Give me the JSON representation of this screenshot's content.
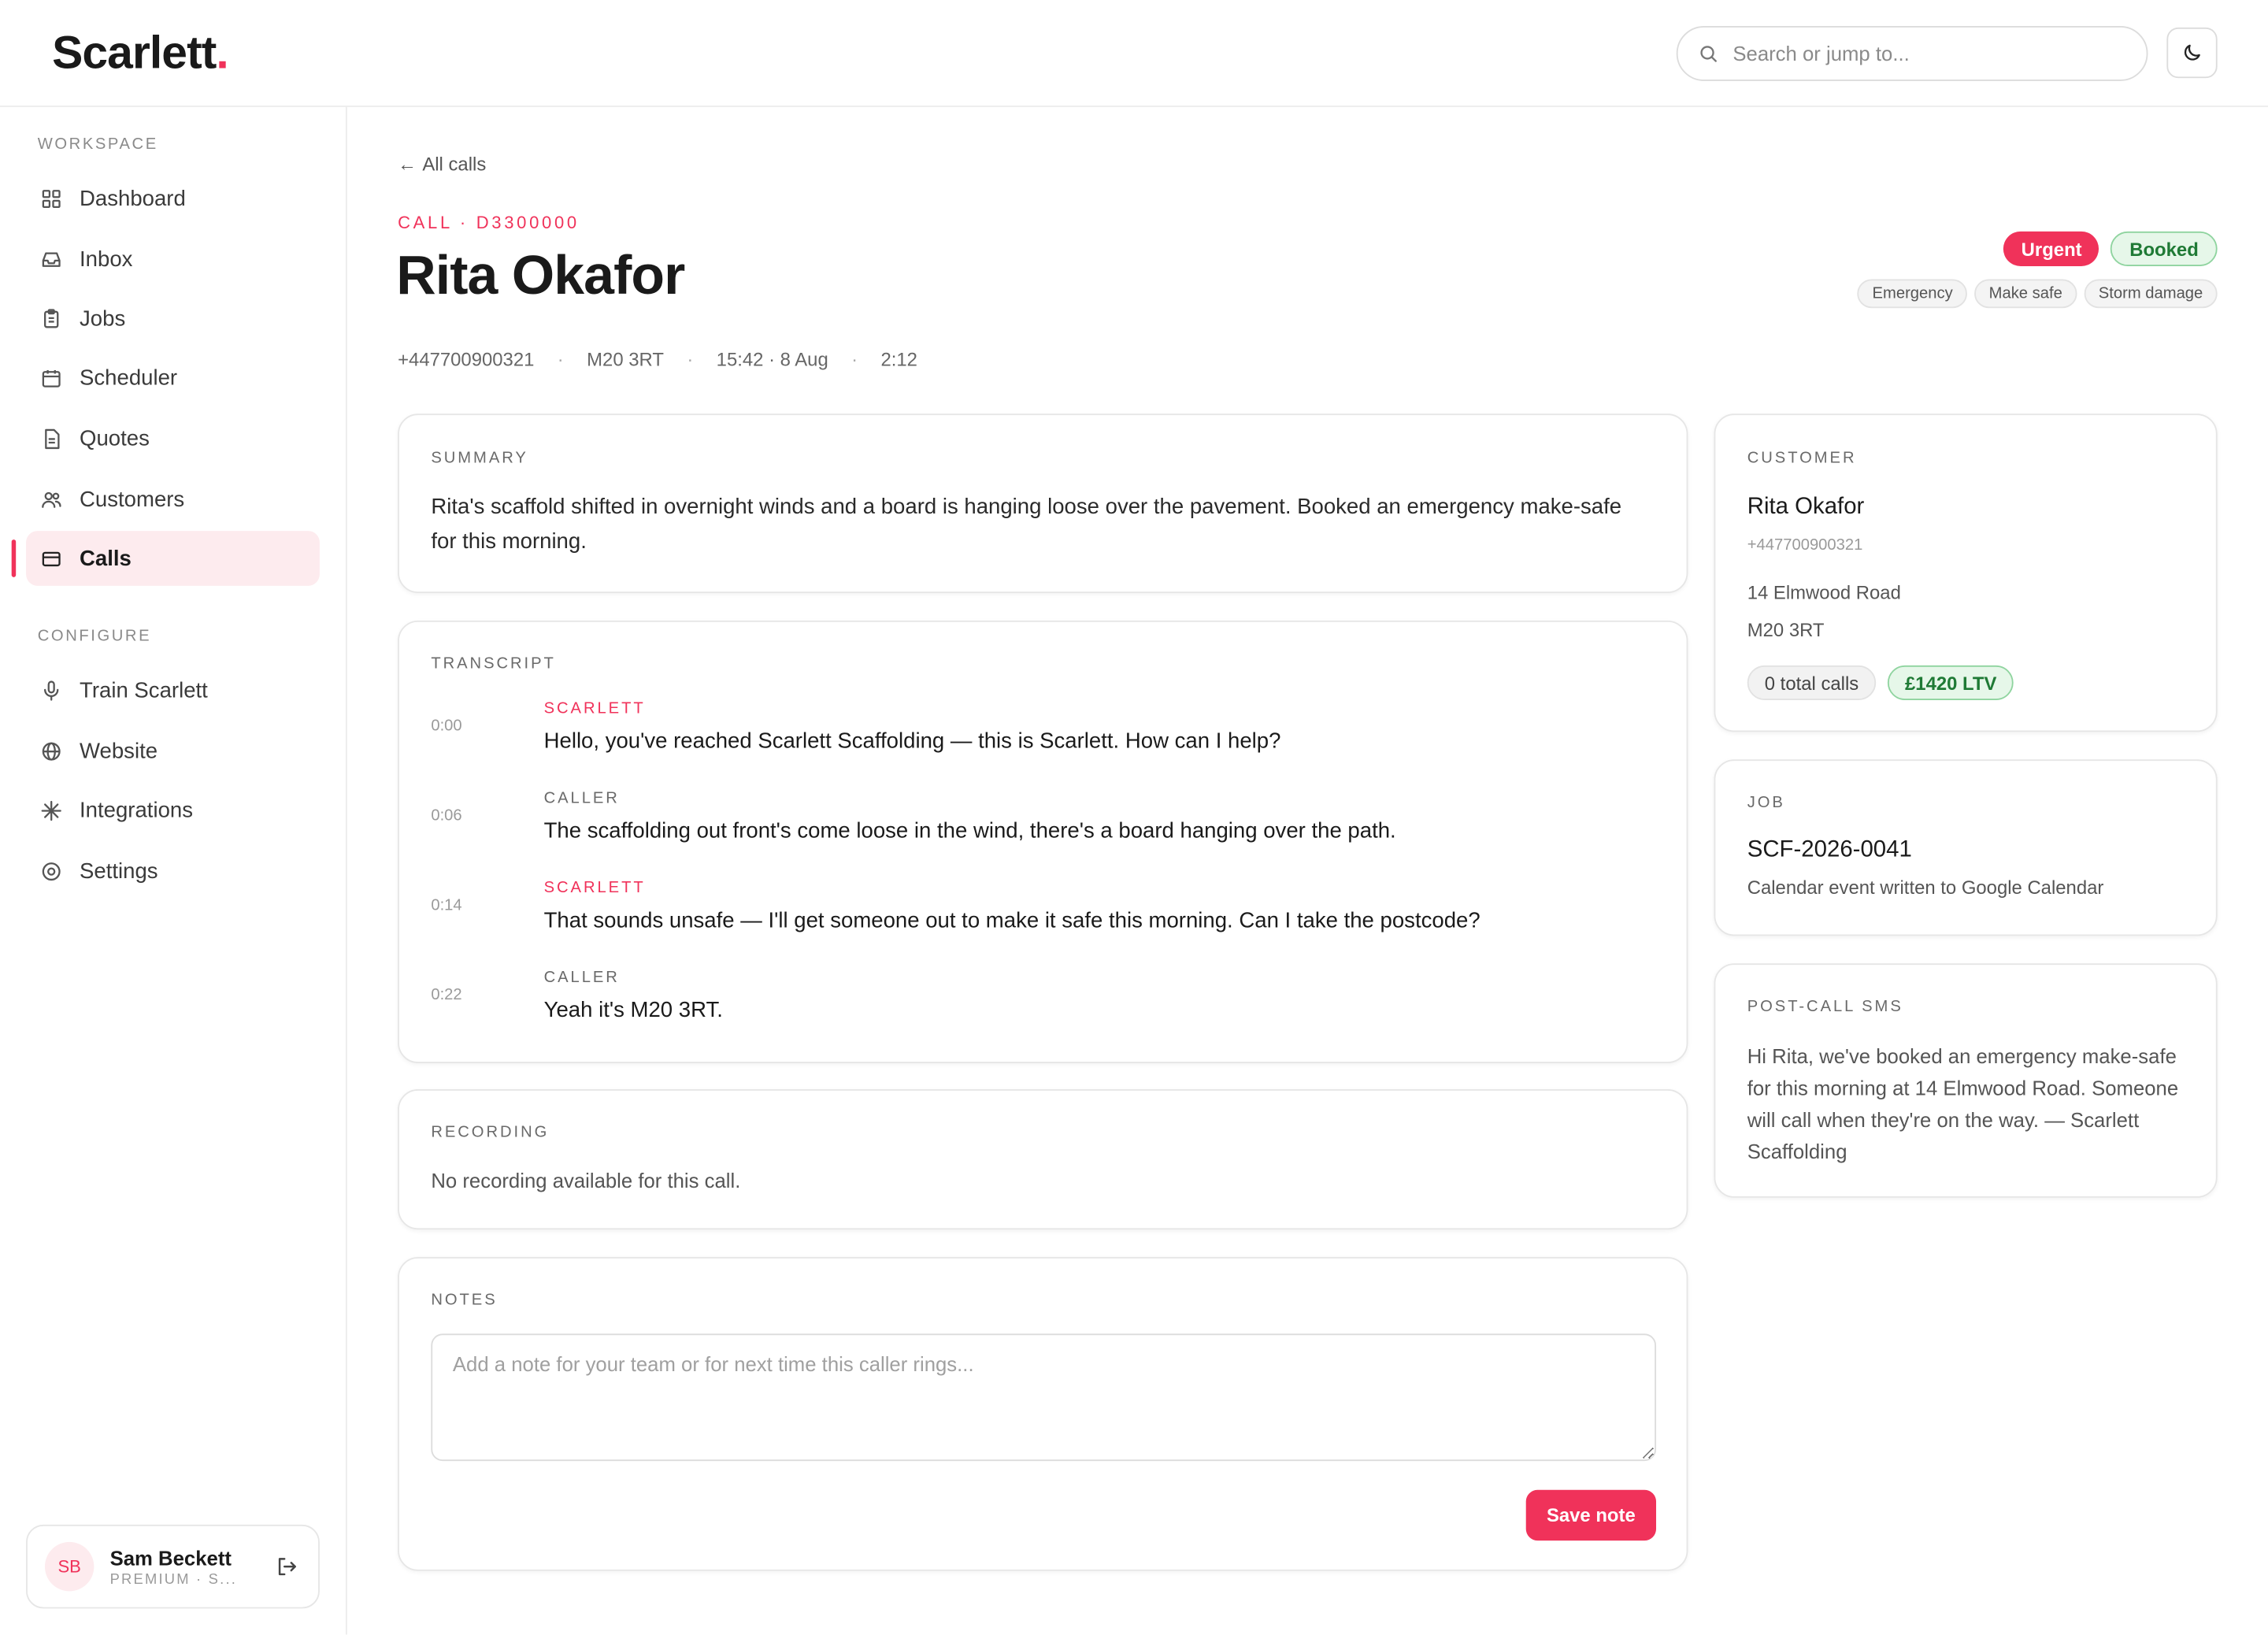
{
  "app": {
    "logo_text": "Scarlett",
    "logo_dot": ".",
    "search_placeholder": "Search or jump to...",
    "accent_color": "#f0325a"
  },
  "sidebar": {
    "workspace_label": "WORKSPACE",
    "configure_label": "CONFIGURE",
    "workspace_items": [
      {
        "label": "Dashboard",
        "icon": "grid-icon"
      },
      {
        "label": "Inbox",
        "icon": "inbox-icon"
      },
      {
        "label": "Jobs",
        "icon": "clipboard-icon"
      },
      {
        "label": "Scheduler",
        "icon": "calendar-icon"
      },
      {
        "label": "Quotes",
        "icon": "document-icon"
      },
      {
        "label": "Customers",
        "icon": "users-icon"
      },
      {
        "label": "Calls",
        "icon": "card-icon",
        "active": true
      }
    ],
    "configure_items": [
      {
        "label": "Train Scarlett",
        "icon": "microphone-icon"
      },
      {
        "label": "Website",
        "icon": "globe-icon"
      },
      {
        "label": "Integrations",
        "icon": "sparkle-icon"
      },
      {
        "label": "Settings",
        "icon": "settings-icon"
      }
    ],
    "user": {
      "initials": "SB",
      "name": "Sam Beckett",
      "plan": "PREMIUM · S..."
    }
  },
  "header": {
    "back_label": "All calls",
    "call_id": "CALL · D3300000",
    "caller_name": "Rita Okafor",
    "meta": [
      "+447700900321",
      "M20 3RT",
      "15:42 · 8 Aug",
      "2:12"
    ],
    "badges": [
      "Urgent",
      "Booked"
    ],
    "tags": [
      "Emergency",
      "Make safe",
      "Storm damage"
    ]
  },
  "summary": {
    "label": "SUMMARY",
    "text": "Rita's scaffold shifted in overnight winds and a board is hanging loose over the pavement. Booked an emergency make-safe for this morning."
  },
  "transcript": {
    "label": "TRANSCRIPT",
    "turns": [
      {
        "time": "0:00",
        "speaker": "SCARLETT",
        "text": "Hello, you've reached Scarlett Scaffolding — this is Scarlett. How can I help?"
      },
      {
        "time": "0:06",
        "speaker": "CALLER",
        "text": "The scaffolding out front's come loose in the wind, there's a board hanging over the path."
      },
      {
        "time": "0:14",
        "speaker": "SCARLETT",
        "text": "That sounds unsafe — I'll get someone out to make it safe this morning. Can I take the postcode?"
      },
      {
        "time": "0:22",
        "speaker": "CALLER",
        "text": "Yeah it's M20 3RT."
      }
    ]
  },
  "recording": {
    "label": "RECORDING",
    "text": "No recording available for this call."
  },
  "notes": {
    "label": "NOTES",
    "placeholder": "Add a note for your team or for next time this caller rings...",
    "save_label": "Save note"
  },
  "customer": {
    "label": "CUSTOMER",
    "name": "Rita Okafor",
    "phone": "+447700900321",
    "address_line1": "14 Elmwood Road",
    "address_line2": "M20 3RT",
    "total_calls": "0 total calls",
    "ltv": "£1420 LTV"
  },
  "job": {
    "label": "JOB",
    "reference": "SCF-2026-0041",
    "status": "Calendar event written to Google Calendar"
  },
  "sms": {
    "label": "POST-CALL SMS",
    "text": "Hi Rita, we've booked an emergency make-safe for this morning at 14 Elmwood Road. Someone will call when they're on the way. — Scarlett Scaffolding"
  }
}
